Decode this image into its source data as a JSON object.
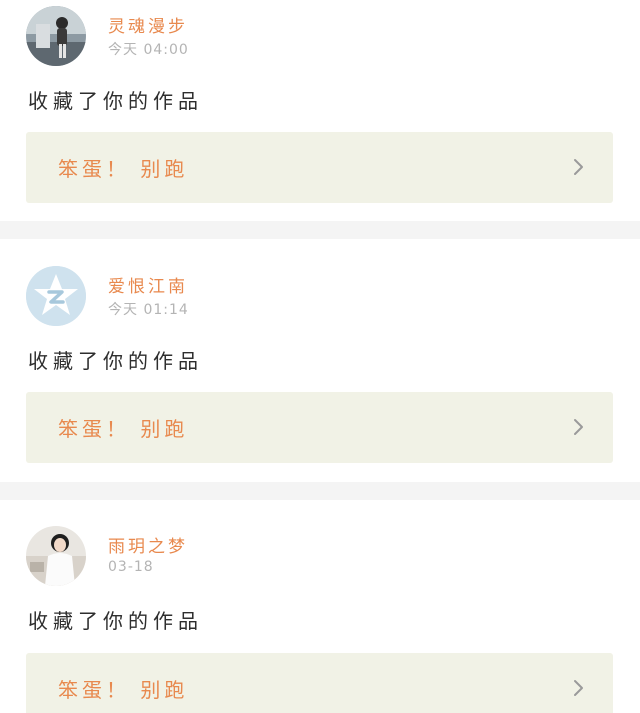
{
  "feed": {
    "items": [
      {
        "username": "灵魂漫步",
        "time": "今天 04:00",
        "action": "收藏了你的作品",
        "work_title": "笨蛋！ 别跑",
        "avatar": "photo-avatar"
      },
      {
        "username": "爱恨江南",
        "time": "今天 01:14",
        "action": "收藏了你的作品",
        "work_title": "笨蛋！ 别跑",
        "avatar": "default-qq-avatar"
      },
      {
        "username": "雨玥之梦",
        "time": "03-18",
        "action": "收藏了你的作品",
        "work_title": "笨蛋！ 别跑",
        "avatar": "photo-avatar"
      }
    ]
  },
  "colors": {
    "accent": "#e8894e",
    "work_bg": "#f1f2e6",
    "divider": "#f4f4f4",
    "time_text": "#b4b4b4",
    "body_text": "#2e2e2e"
  }
}
